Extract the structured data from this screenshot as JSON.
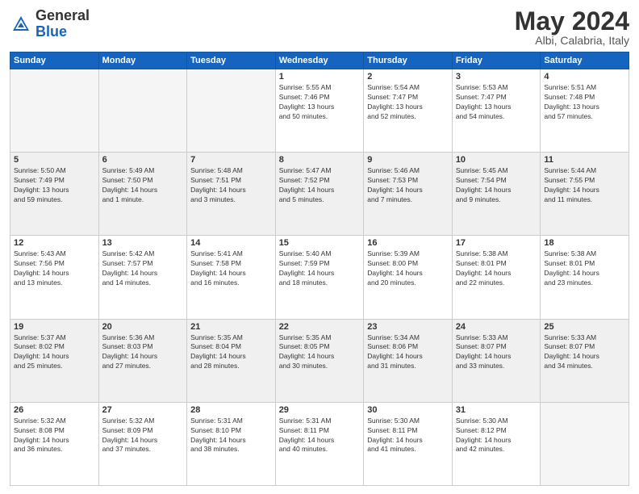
{
  "header": {
    "logo_general": "General",
    "logo_blue": "Blue",
    "month_title": "May 2024",
    "location": "Albi, Calabria, Italy"
  },
  "days_of_week": [
    "Sunday",
    "Monday",
    "Tuesday",
    "Wednesday",
    "Thursday",
    "Friday",
    "Saturday"
  ],
  "weeks": [
    {
      "shaded": false,
      "days": [
        {
          "num": "",
          "info": ""
        },
        {
          "num": "",
          "info": ""
        },
        {
          "num": "",
          "info": ""
        },
        {
          "num": "1",
          "info": "Sunrise: 5:55 AM\nSunset: 7:46 PM\nDaylight: 13 hours\nand 50 minutes."
        },
        {
          "num": "2",
          "info": "Sunrise: 5:54 AM\nSunset: 7:47 PM\nDaylight: 13 hours\nand 52 minutes."
        },
        {
          "num": "3",
          "info": "Sunrise: 5:53 AM\nSunset: 7:47 PM\nDaylight: 13 hours\nand 54 minutes."
        },
        {
          "num": "4",
          "info": "Sunrise: 5:51 AM\nSunset: 7:48 PM\nDaylight: 13 hours\nand 57 minutes."
        }
      ]
    },
    {
      "shaded": true,
      "days": [
        {
          "num": "5",
          "info": "Sunrise: 5:50 AM\nSunset: 7:49 PM\nDaylight: 13 hours\nand 59 minutes."
        },
        {
          "num": "6",
          "info": "Sunrise: 5:49 AM\nSunset: 7:50 PM\nDaylight: 14 hours\nand 1 minute."
        },
        {
          "num": "7",
          "info": "Sunrise: 5:48 AM\nSunset: 7:51 PM\nDaylight: 14 hours\nand 3 minutes."
        },
        {
          "num": "8",
          "info": "Sunrise: 5:47 AM\nSunset: 7:52 PM\nDaylight: 14 hours\nand 5 minutes."
        },
        {
          "num": "9",
          "info": "Sunrise: 5:46 AM\nSunset: 7:53 PM\nDaylight: 14 hours\nand 7 minutes."
        },
        {
          "num": "10",
          "info": "Sunrise: 5:45 AM\nSunset: 7:54 PM\nDaylight: 14 hours\nand 9 minutes."
        },
        {
          "num": "11",
          "info": "Sunrise: 5:44 AM\nSunset: 7:55 PM\nDaylight: 14 hours\nand 11 minutes."
        }
      ]
    },
    {
      "shaded": false,
      "days": [
        {
          "num": "12",
          "info": "Sunrise: 5:43 AM\nSunset: 7:56 PM\nDaylight: 14 hours\nand 13 minutes."
        },
        {
          "num": "13",
          "info": "Sunrise: 5:42 AM\nSunset: 7:57 PM\nDaylight: 14 hours\nand 14 minutes."
        },
        {
          "num": "14",
          "info": "Sunrise: 5:41 AM\nSunset: 7:58 PM\nDaylight: 14 hours\nand 16 minutes."
        },
        {
          "num": "15",
          "info": "Sunrise: 5:40 AM\nSunset: 7:59 PM\nDaylight: 14 hours\nand 18 minutes."
        },
        {
          "num": "16",
          "info": "Sunrise: 5:39 AM\nSunset: 8:00 PM\nDaylight: 14 hours\nand 20 minutes."
        },
        {
          "num": "17",
          "info": "Sunrise: 5:38 AM\nSunset: 8:01 PM\nDaylight: 14 hours\nand 22 minutes."
        },
        {
          "num": "18",
          "info": "Sunrise: 5:38 AM\nSunset: 8:01 PM\nDaylight: 14 hours\nand 23 minutes."
        }
      ]
    },
    {
      "shaded": true,
      "days": [
        {
          "num": "19",
          "info": "Sunrise: 5:37 AM\nSunset: 8:02 PM\nDaylight: 14 hours\nand 25 minutes."
        },
        {
          "num": "20",
          "info": "Sunrise: 5:36 AM\nSunset: 8:03 PM\nDaylight: 14 hours\nand 27 minutes."
        },
        {
          "num": "21",
          "info": "Sunrise: 5:35 AM\nSunset: 8:04 PM\nDaylight: 14 hours\nand 28 minutes."
        },
        {
          "num": "22",
          "info": "Sunrise: 5:35 AM\nSunset: 8:05 PM\nDaylight: 14 hours\nand 30 minutes."
        },
        {
          "num": "23",
          "info": "Sunrise: 5:34 AM\nSunset: 8:06 PM\nDaylight: 14 hours\nand 31 minutes."
        },
        {
          "num": "24",
          "info": "Sunrise: 5:33 AM\nSunset: 8:07 PM\nDaylight: 14 hours\nand 33 minutes."
        },
        {
          "num": "25",
          "info": "Sunrise: 5:33 AM\nSunset: 8:07 PM\nDaylight: 14 hours\nand 34 minutes."
        }
      ]
    },
    {
      "shaded": false,
      "days": [
        {
          "num": "26",
          "info": "Sunrise: 5:32 AM\nSunset: 8:08 PM\nDaylight: 14 hours\nand 36 minutes."
        },
        {
          "num": "27",
          "info": "Sunrise: 5:32 AM\nSunset: 8:09 PM\nDaylight: 14 hours\nand 37 minutes."
        },
        {
          "num": "28",
          "info": "Sunrise: 5:31 AM\nSunset: 8:10 PM\nDaylight: 14 hours\nand 38 minutes."
        },
        {
          "num": "29",
          "info": "Sunrise: 5:31 AM\nSunset: 8:11 PM\nDaylight: 14 hours\nand 40 minutes."
        },
        {
          "num": "30",
          "info": "Sunrise: 5:30 AM\nSunset: 8:11 PM\nDaylight: 14 hours\nand 41 minutes."
        },
        {
          "num": "31",
          "info": "Sunrise: 5:30 AM\nSunset: 8:12 PM\nDaylight: 14 hours\nand 42 minutes."
        },
        {
          "num": "",
          "info": ""
        }
      ]
    }
  ]
}
